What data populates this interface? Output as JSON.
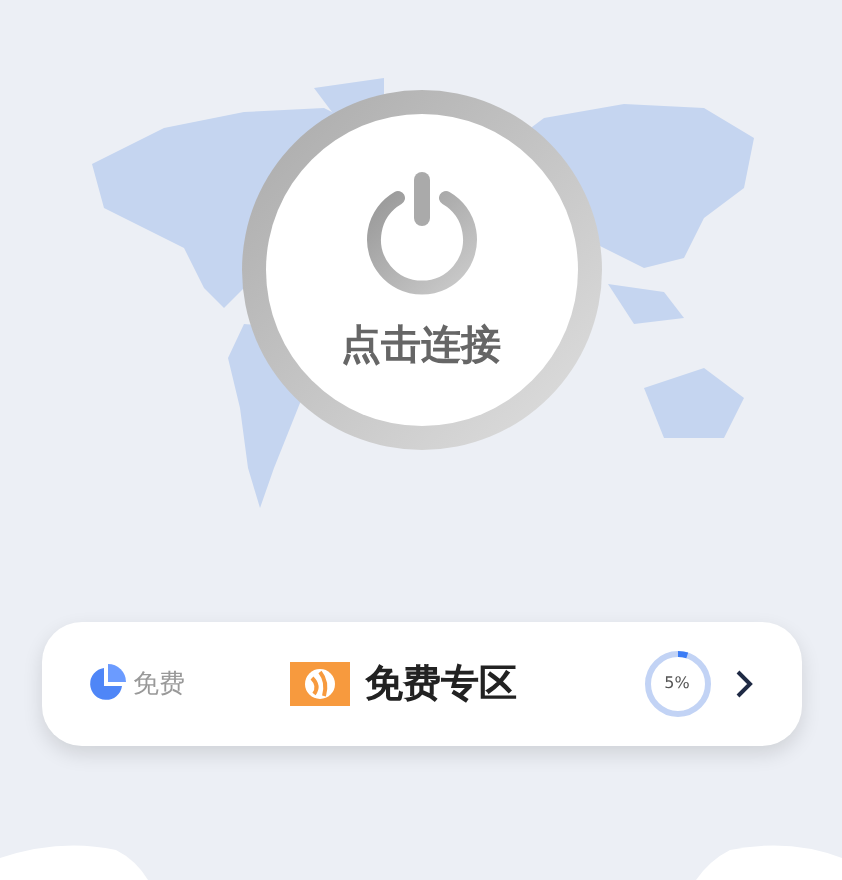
{
  "connect_button": {
    "label": "点击连接",
    "connected": false
  },
  "zone_card": {
    "plan": "免费",
    "title": "免费专区",
    "usage": {
      "reading": "5%"
    }
  }
}
